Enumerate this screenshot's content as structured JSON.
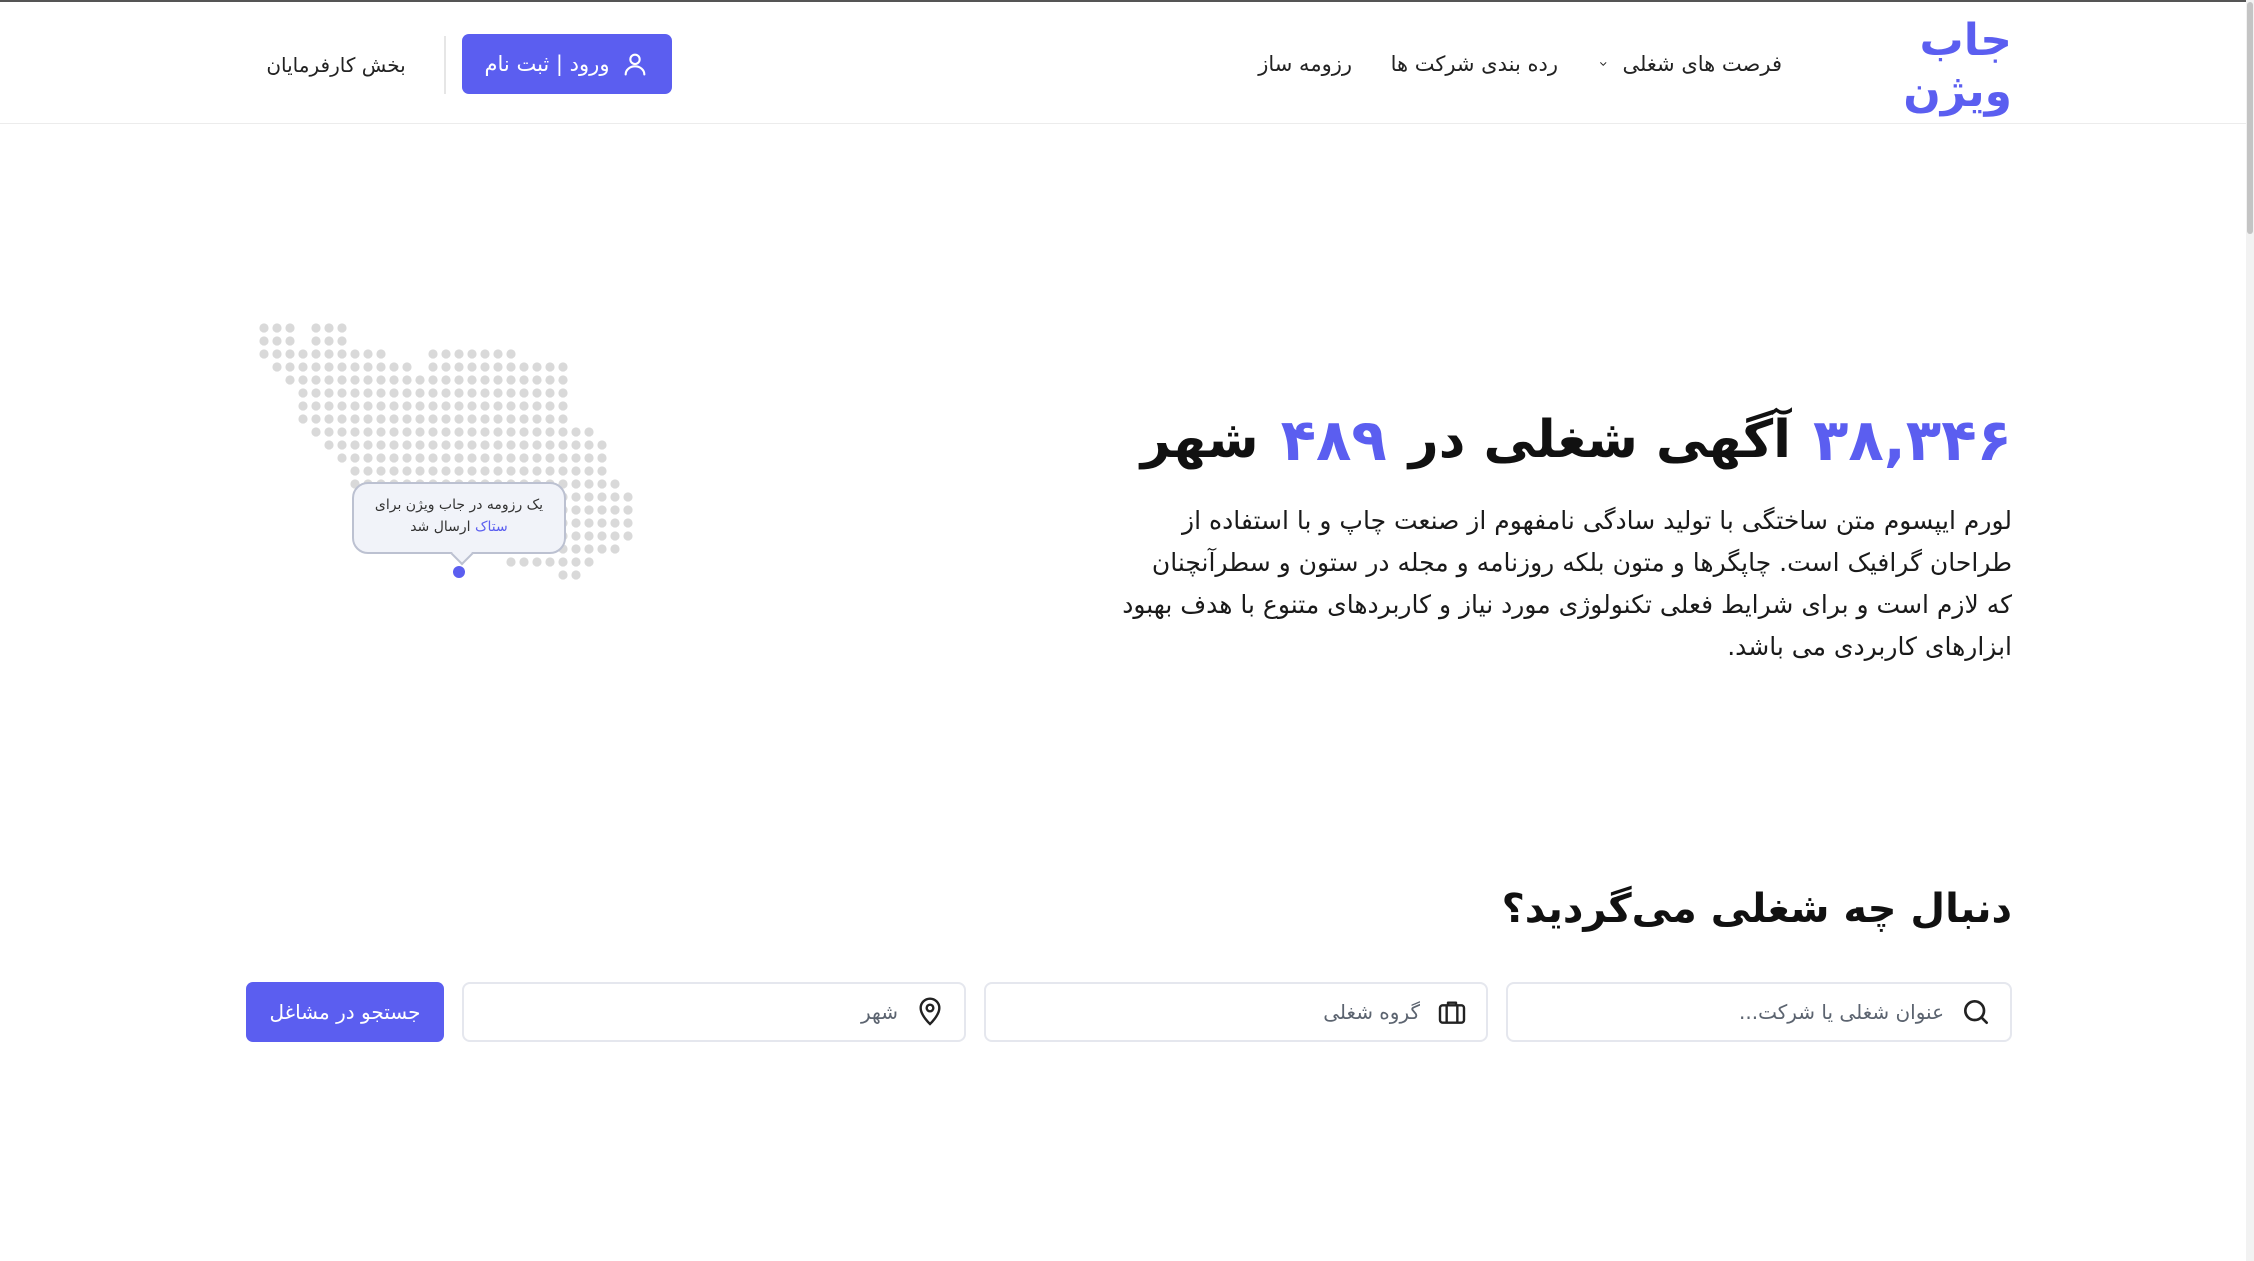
{
  "header": {
    "logo": "جاب ویژن",
    "nav": {
      "jobs": "فرصت های شغلی",
      "ranking": "رده بندی شرکت ها",
      "resume_builder": "رزومه ساز"
    },
    "login_label": "ورود | ثبت نام",
    "employers_label": "بخش کارفرمایان"
  },
  "hero": {
    "job_count": "۳۸,۳۴۶",
    "title_middle": "آگهی شغلی در",
    "city_count": "۴۸۹",
    "title_end": "شهر",
    "description": "لورم ایپسوم متن ساختگی با تولید سادگی نامفهوم از صنعت چاپ و با استفاده از طراحان گرافیک است. چاپگرها و متون بلکه روزنامه و مجله در ستون و سطرآنچنان که لازم است و برای شرایط فعلی تکنولوژی مورد نیاز و کاربردهای متنوع با هدف بهبود ابزارهای کاربردی می باشد.",
    "tooltip_line1": "یک رزومه در جاب ویژن برای",
    "tooltip_company": "ستاک",
    "tooltip_line2_end": "ارسال شد"
  },
  "search": {
    "title": "دنبال چه شغلی می‌گردید؟",
    "title_placeholder": "عنوان شغلی یا شرکت...",
    "group_placeholder": "گروه شغلی",
    "city_placeholder": "شهر",
    "button_label": "جستجو در مشاغل"
  },
  "colors": {
    "accent": "#5b5ef0",
    "map_dot": "#d9d9d9"
  },
  "icons": {
    "user": "user-icon",
    "chevron": "chevron-down-icon",
    "search": "search-icon",
    "briefcase": "briefcase-icon",
    "location": "location-pin-icon"
  }
}
